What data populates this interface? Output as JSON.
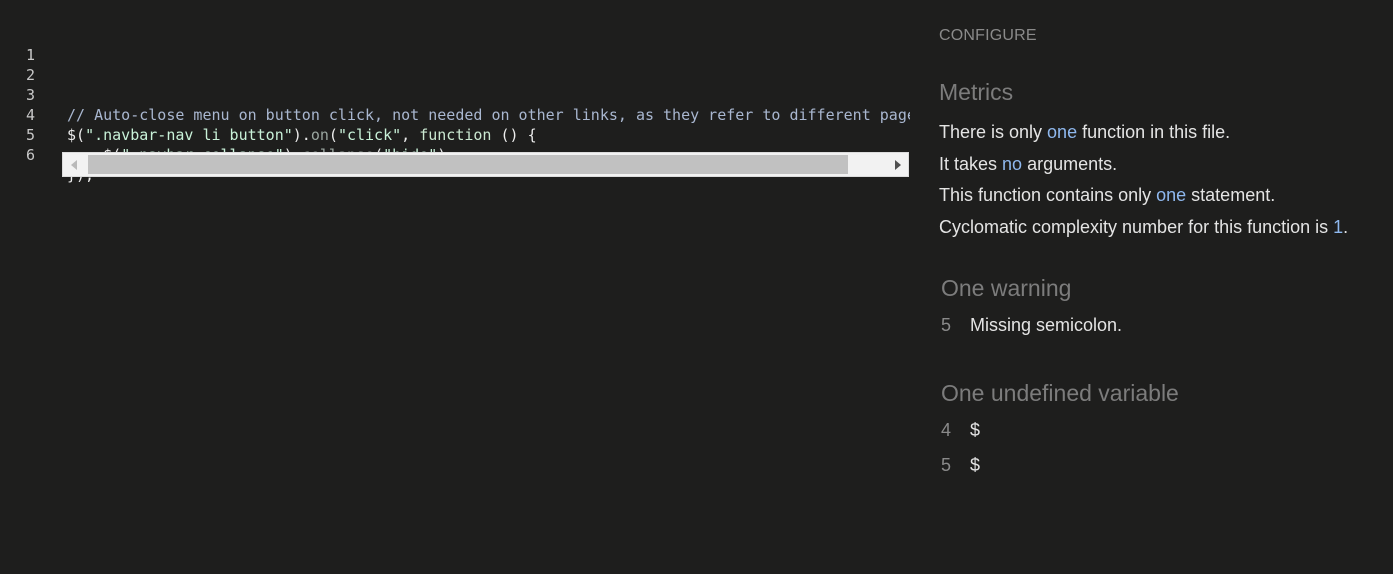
{
  "editor": {
    "line_numbers": [
      "1",
      "2",
      "3",
      "4",
      "5",
      "6"
    ],
    "line3": {
      "comment": "// Auto-close menu on button click, not needed on other links, as they refer to different pages"
    },
    "line4": {
      "p1": "$(",
      "s1": "\".navbar-nav li button\"",
      "p2": ").",
      "m1": "on",
      "p3": "(",
      "s2": "\"click\"",
      "p4": ", ",
      "kw": "function",
      "p5": " () {"
    },
    "line5": {
      "indent": "    ",
      "p1": "$(",
      "s1": "\".navbar-collapse\"",
      "p2": ").",
      "m1": "collapse",
      "p3": "(",
      "s2": "\"hide\"",
      "p4": ")"
    },
    "line6": {
      "text": "});"
    }
  },
  "panel": {
    "configure_label": "CONFIGURE",
    "metrics_title": "Metrics",
    "metrics": {
      "m1_a": "There is only ",
      "m1_b": "one",
      "m1_c": " function in this file.",
      "m2_a": "It takes ",
      "m2_b": "no",
      "m2_c": " arguments.",
      "m3_a": "This function contains only ",
      "m3_b": "one",
      "m3_c": " statement.",
      "m4_a": "Cyclomatic complexity number for this function is ",
      "m4_b": "1",
      "m4_c": "."
    },
    "warnings_title": "One warning",
    "warnings": [
      {
        "line": "5",
        "message": "Missing semicolon."
      }
    ],
    "undefined_title": "One undefined variable",
    "undefined": [
      {
        "line": "4",
        "name": "$"
      },
      {
        "line": "5",
        "name": "$"
      }
    ]
  },
  "colors": {
    "background": "#1e1e1d",
    "highlight": "#8fb8ee",
    "comment": "#a9b7d0",
    "string": "#c9f2d9"
  }
}
